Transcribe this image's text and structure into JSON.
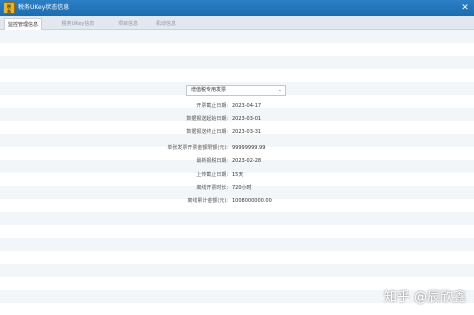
{
  "window": {
    "title": "税务UKey状态信息",
    "close_glyph": "✕"
  },
  "tabs": [
    {
      "label": "监控管理信息",
      "active": true
    },
    {
      "label": "税务UKey信息",
      "active": false
    },
    {
      "label": "项目信息",
      "active": false
    },
    {
      "label": "机动信息",
      "active": false
    }
  ],
  "invoice_type_select": {
    "value": "增值税专用发票",
    "arrow": "⌄"
  },
  "fields": [
    {
      "label": "开票截止日期:",
      "value": "2023-04-17"
    },
    {
      "label": "数据报送起始日期:",
      "value": "2023-03-01"
    },
    {
      "label": "数据报送终止日期:",
      "value": "2023-03-31"
    },
    {
      "label": "单张发票开票金额限额(元):",
      "value": "99999999.99"
    },
    {
      "label": "最新报税日期:",
      "value": "2023-02-28"
    },
    {
      "label": "上传截止日期:",
      "value": "15天"
    },
    {
      "label": "离线开票时长:",
      "value": "720小时"
    },
    {
      "label": "离线累计金额(元):",
      "value": "1008000000.00"
    }
  ],
  "watermark": "知乎 @辰欣鑫",
  "colors": {
    "titlebar": "#1d6cb0",
    "tabbar": "#e2e8ef",
    "stripe": "#f3f6f9"
  },
  "icons": {
    "app": "app-logo-icon",
    "close": "close-icon",
    "dropdown": "chevron-down-icon"
  }
}
